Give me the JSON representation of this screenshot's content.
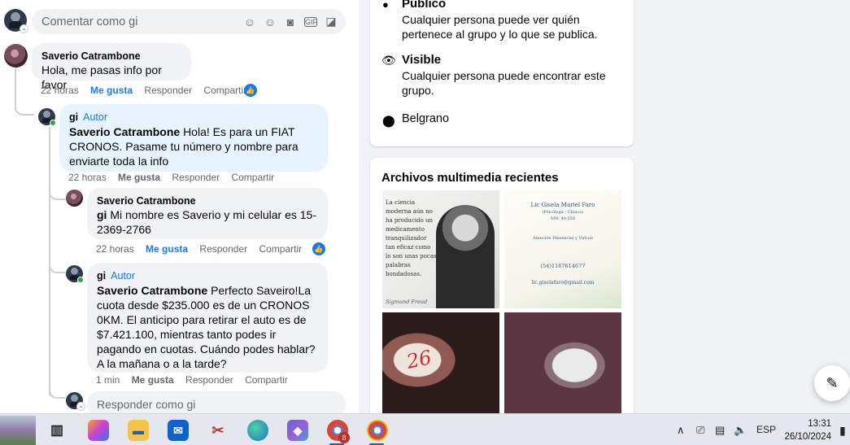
{
  "top_comment_box": {
    "placeholder": "Comentar como gi",
    "icons": [
      "sticker-outline-icon",
      "emoji-icon",
      "camera-icon",
      "gif-icon",
      "sticker-icon"
    ]
  },
  "comments": [
    {
      "author": "Saverio Catrambone",
      "text": "Hola, me pasas info por favor",
      "time": "22 horas",
      "like": "Me gusta",
      "reply": "Responder",
      "share": "Compartir",
      "liked": true
    },
    {
      "author": "gi",
      "badge": "Autor",
      "mention": "Saverio Catrambone",
      "text": "Hola! Es para un FIAT CRONOS. Pasame tu número y nombre para enviarte toda la info",
      "time": "22 horas",
      "like": "Me gusta",
      "reply": "Responder",
      "share": "Compartir"
    },
    {
      "author": "Saverio Catrambone",
      "mention": "gi",
      "text": "Mi nombre es Saverio y mi celular es 15-2369-2766",
      "time": "22 horas",
      "like": "Me gusta",
      "reply": "Responder",
      "share": "Compartir",
      "liked": true
    },
    {
      "author": "gi",
      "badge": "Autor",
      "mention": "Saverio Catrambone",
      "text": "Perfecto Saveiro!La cuota desde $235.000 es de un CRONOS 0KM. El anticipo para retirar el auto es de $7.421.100, mientras tanto podes ir pagando en cuotas. Cuándo podes hablar? A la mañana o a la tarde?",
      "time": "1 min",
      "like": "Me gusta",
      "reply": "Responder",
      "share": "Compartir"
    }
  ],
  "reply_box": {
    "placeholder": "Responder como gi"
  },
  "about": {
    "public_title": "Público",
    "public_desc": "Cualquier persona puede ver quién pertenece al grupo y lo que se publica.",
    "visible_title": "Visible",
    "visible_desc": "Cualquier persona puede encontrar este grupo.",
    "location": "Belgrano"
  },
  "media": {
    "title": "Archivos multimedia recientes",
    "quote": "La ciencia moderna aún no ha producido un medicamento tranquilizador tan eficaz como lo son unas pocas palabras bondadosas.",
    "quote_author": "Sigmund Freud",
    "card_name": "Lic Gisela Mariel Faro",
    "card_line1": "(Psicóloga - Clínica)",
    "card_line2": "MN: 40.558",
    "card_line3": "Atención Presencial y Virtual",
    "card_phone": "(54)1167614677",
    "card_email": "lic.giselafaro@gmail.com",
    "shoe_mark": "26"
  },
  "taskbar": {
    "lang": "ESP",
    "time": "13:31",
    "date": "26/10/2024",
    "badge_count": "8"
  }
}
